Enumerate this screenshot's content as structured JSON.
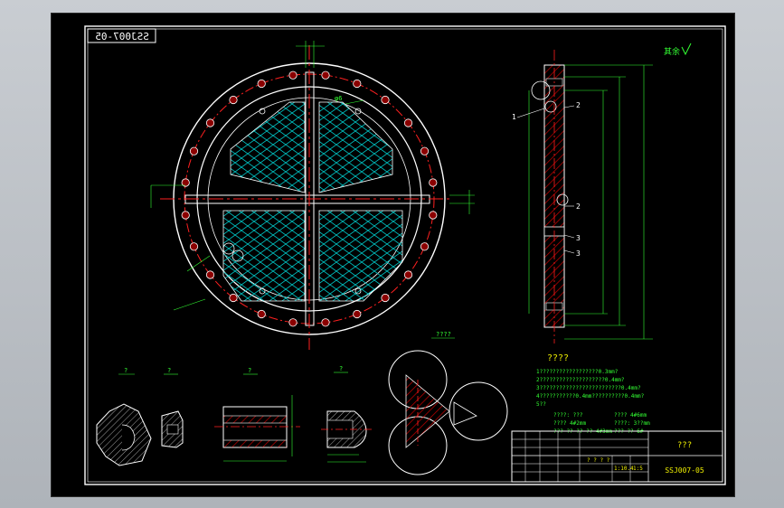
{
  "drawing_code_mirrored": "SSJ007-05",
  "drawing_code": "SSJ007-05",
  "title_block": {
    "title": "???",
    "code": "SSJ007-05",
    "cells": [
      "? ? ? ?",
      "1:10.4",
      "1:5"
    ]
  },
  "roughness_note": "其余",
  "tech_requirements": {
    "heading": "????",
    "lines": [
      "1??????????????????0.3mm?",
      "2????????????????????0.4mm?",
      "3?????????????????????????0.4mm?",
      "4???????????0.4mm??????????0.4mm?",
      "5??"
    ],
    "params": [
      "????: ???",
      "???? 4#2mm",
      "??? ?? ?? ?? 4#3mm",
      "???? 4#6mm",
      "????: 3??mm",
      "??? ?? 6#"
    ]
  },
  "view_labels": {
    "detail_a": "?",
    "detail_b": "?",
    "detail_c": "?",
    "detail_d": "?",
    "detail_e": "?",
    "section_label": "????"
  },
  "callouts": [
    "1",
    "2",
    "2",
    "3",
    "3"
  ],
  "colors": {
    "background": "#000000",
    "frame": "#ffffff",
    "center_line": "#ff2020",
    "hatch": "#00c8c8",
    "dimension": "#33ff33",
    "hole_fill": "#8b0000",
    "section_hatch": "#c80000"
  }
}
